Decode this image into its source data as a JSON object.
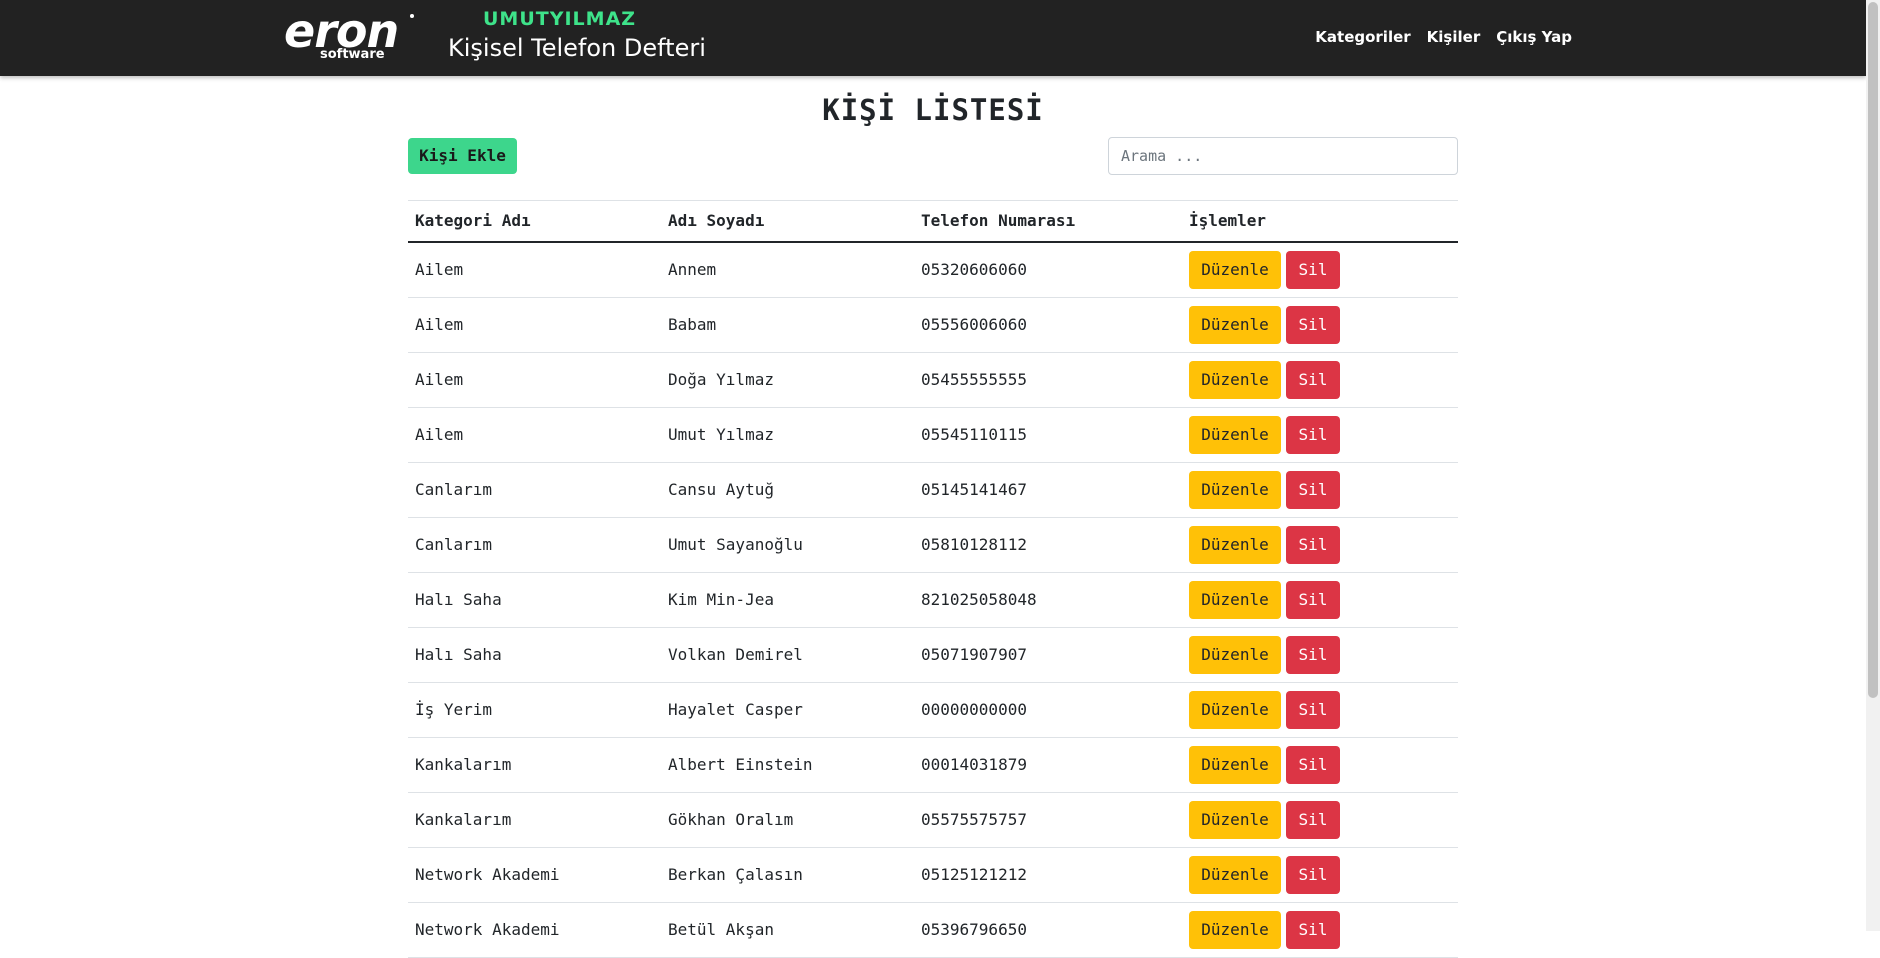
{
  "navbar": {
    "logo_word": "eron",
    "logo_sub": "software",
    "tagline_name": "UMUTYILMAZ",
    "tagline_title": "Kişisel Telefon Defteri",
    "links": [
      "Kategoriler",
      "Kişiler",
      "Çıkış Yap"
    ]
  },
  "page": {
    "title": "KİŞİ LİSTESİ",
    "add_button": "Kişi Ekle",
    "search_placeholder": "Arama ...",
    "search_value": ""
  },
  "table": {
    "headers": [
      "Kategori Adı",
      "Adı Soyadı",
      "Telefon Numarası",
      "İşlemler"
    ],
    "edit_label": "Düzenle",
    "delete_label": "Sil",
    "rows": [
      {
        "category": "Ailem",
        "name": "Annem",
        "phone": "05320606060"
      },
      {
        "category": "Ailem",
        "name": "Babam",
        "phone": "05556006060"
      },
      {
        "category": "Ailem",
        "name": "Doğa Yılmaz",
        "phone": "05455555555"
      },
      {
        "category": "Ailem",
        "name": "Umut Yılmaz",
        "phone": "05545110115"
      },
      {
        "category": "Canlarım",
        "name": "Cansu Aytuğ",
        "phone": "05145141467"
      },
      {
        "category": "Canlarım",
        "name": "Umut Sayanoğlu",
        "phone": "05810128112"
      },
      {
        "category": "Halı Saha",
        "name": "Kim Min-Jea",
        "phone": "821025058048"
      },
      {
        "category": "Halı Saha",
        "name": "Volkan Demirel",
        "phone": "05071907907"
      },
      {
        "category": "İş Yerim",
        "name": "Hayalet Casper",
        "phone": "00000000000"
      },
      {
        "category": "Kankalarım",
        "name": "Albert Einstein",
        "phone": "00014031879"
      },
      {
        "category": "Kankalarım",
        "name": "Gökhan Oralım",
        "phone": "05575575757"
      },
      {
        "category": "Network Akademi",
        "name": "Berkan Çalasın",
        "phone": "05125121212"
      },
      {
        "category": "Network Akademi",
        "name": "Betül Akşan",
        "phone": "05396796650"
      }
    ]
  },
  "colors": {
    "navbar_bg": "#222222",
    "accent_green": "#3dd68c",
    "edit_yellow": "#ffc107",
    "delete_red": "#dc3545"
  }
}
